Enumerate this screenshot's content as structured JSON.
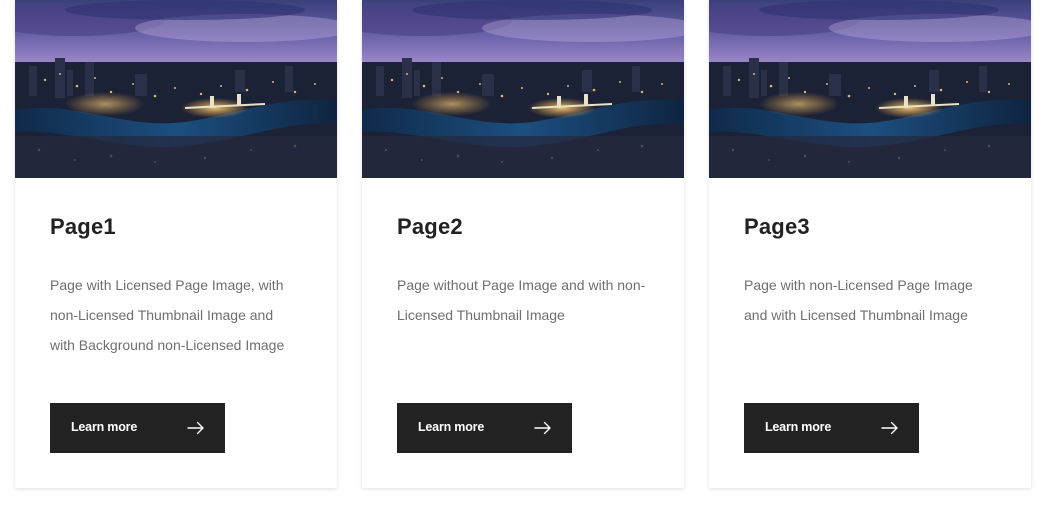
{
  "colors": {
    "button_bg": "#222222",
    "button_text": "#ffffff",
    "title_text": "#222222",
    "desc_text": "#6f6f6f"
  },
  "cards": [
    {
      "image": "city-night-skyline-image",
      "title": "Page1",
      "description": "Page with Licensed Page Image, with non-Licensed Thumbnail Image and with Background non-Licensed Image",
      "button_label": "Learn more",
      "button_icon": "arrow-right-icon"
    },
    {
      "image": "city-night-skyline-image",
      "title": "Page2",
      "description": "Page without Page Image and with non-Licensed Thumbnail Image",
      "button_label": "Learn more",
      "button_icon": "arrow-right-icon"
    },
    {
      "image": "city-night-skyline-image",
      "title": "Page3",
      "description": "Page with non-Licensed Page Image and with Licensed Thumbnail Image",
      "button_label": "Learn more",
      "button_icon": "arrow-right-icon"
    }
  ]
}
